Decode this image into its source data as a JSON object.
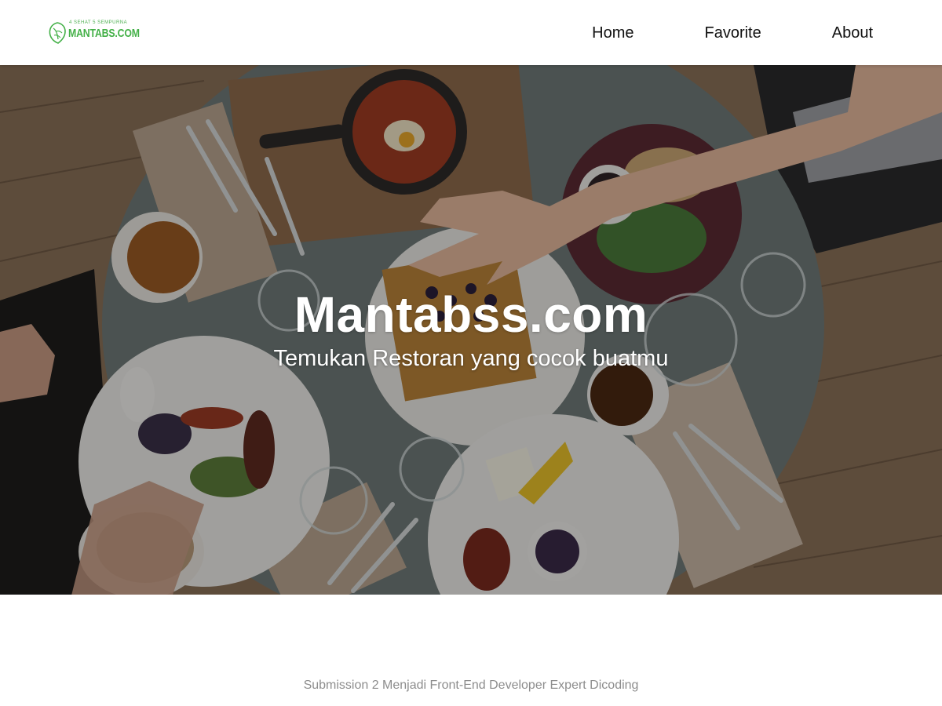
{
  "header": {
    "logo": {
      "tagline": "4 SEHAT 5 SEMPURNA",
      "name": "MANTABS.COM",
      "color": "#43b047"
    },
    "nav": [
      {
        "label": "Home"
      },
      {
        "label": "Favorite"
      },
      {
        "label": "About"
      }
    ]
  },
  "hero": {
    "title": "Mantabss.com",
    "subtitle": "Temukan Restoran yang cocok buatmu",
    "image_icon": "restaurant-table-photo"
  },
  "footer": {
    "text": "Submission 2 Menjadi Front-End Developer Expert Dicoding"
  }
}
